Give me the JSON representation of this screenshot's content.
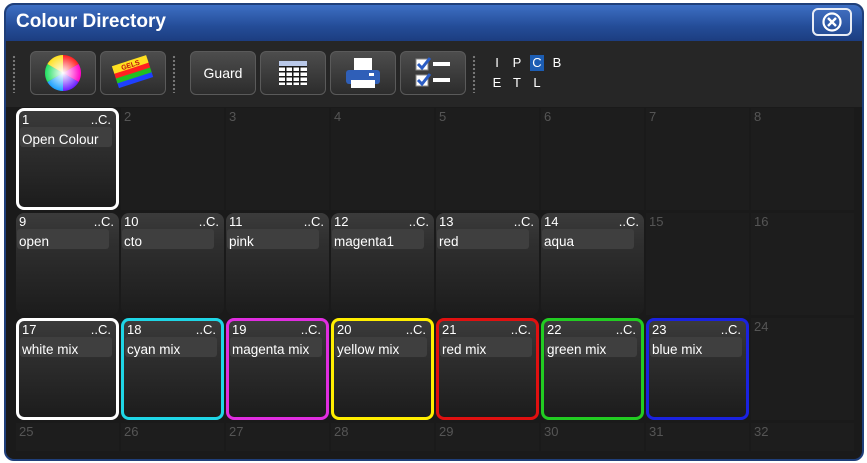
{
  "window": {
    "title": "Colour Directory"
  },
  "toolbar": {
    "guard_label": "Guard",
    "filters_row1": [
      "I",
      "P",
      "C",
      "B"
    ],
    "filters_row2": [
      "E",
      "T",
      "L"
    ],
    "active_filter": "C"
  },
  "cells": [
    {
      "num": "1",
      "tag": "..C.",
      "name": "Open Colour",
      "border": "#ffffff"
    },
    {
      "num": "2"
    },
    {
      "num": "3"
    },
    {
      "num": "4"
    },
    {
      "num": "5"
    },
    {
      "num": "6"
    },
    {
      "num": "7"
    },
    {
      "num": "8"
    },
    {
      "num": "9",
      "tag": "..C.",
      "name": "open"
    },
    {
      "num": "10",
      "tag": "..C.",
      "name": "cto"
    },
    {
      "num": "11",
      "tag": "..C.",
      "name": "pink"
    },
    {
      "num": "12",
      "tag": "..C.",
      "name": "magenta1"
    },
    {
      "num": "13",
      "tag": "..C.",
      "name": "red"
    },
    {
      "num": "14",
      "tag": "..C.",
      "name": "aqua"
    },
    {
      "num": "15"
    },
    {
      "num": "16"
    },
    {
      "num": "17",
      "tag": "..C.",
      "name": "white mix",
      "border": "#ffffff"
    },
    {
      "num": "18",
      "tag": "..C.",
      "name": "cyan mix",
      "border": "#1fd6e6"
    },
    {
      "num": "19",
      "tag": "..C.",
      "name": "magenta mix",
      "border": "#e02de0"
    },
    {
      "num": "20",
      "tag": "..C.",
      "name": "yellow mix",
      "border": "#ffee00"
    },
    {
      "num": "21",
      "tag": "..C.",
      "name": "red mix",
      "border": "#e01010"
    },
    {
      "num": "22",
      "tag": "..C.",
      "name": "green mix",
      "border": "#22cc22"
    },
    {
      "num": "23",
      "tag": "..C.",
      "name": "blue mix",
      "border": "#1a22e0"
    },
    {
      "num": "24"
    },
    {
      "num": "25"
    },
    {
      "num": "26"
    },
    {
      "num": "27"
    },
    {
      "num": "28"
    },
    {
      "num": "29"
    },
    {
      "num": "30"
    },
    {
      "num": "31"
    },
    {
      "num": "32"
    }
  ]
}
